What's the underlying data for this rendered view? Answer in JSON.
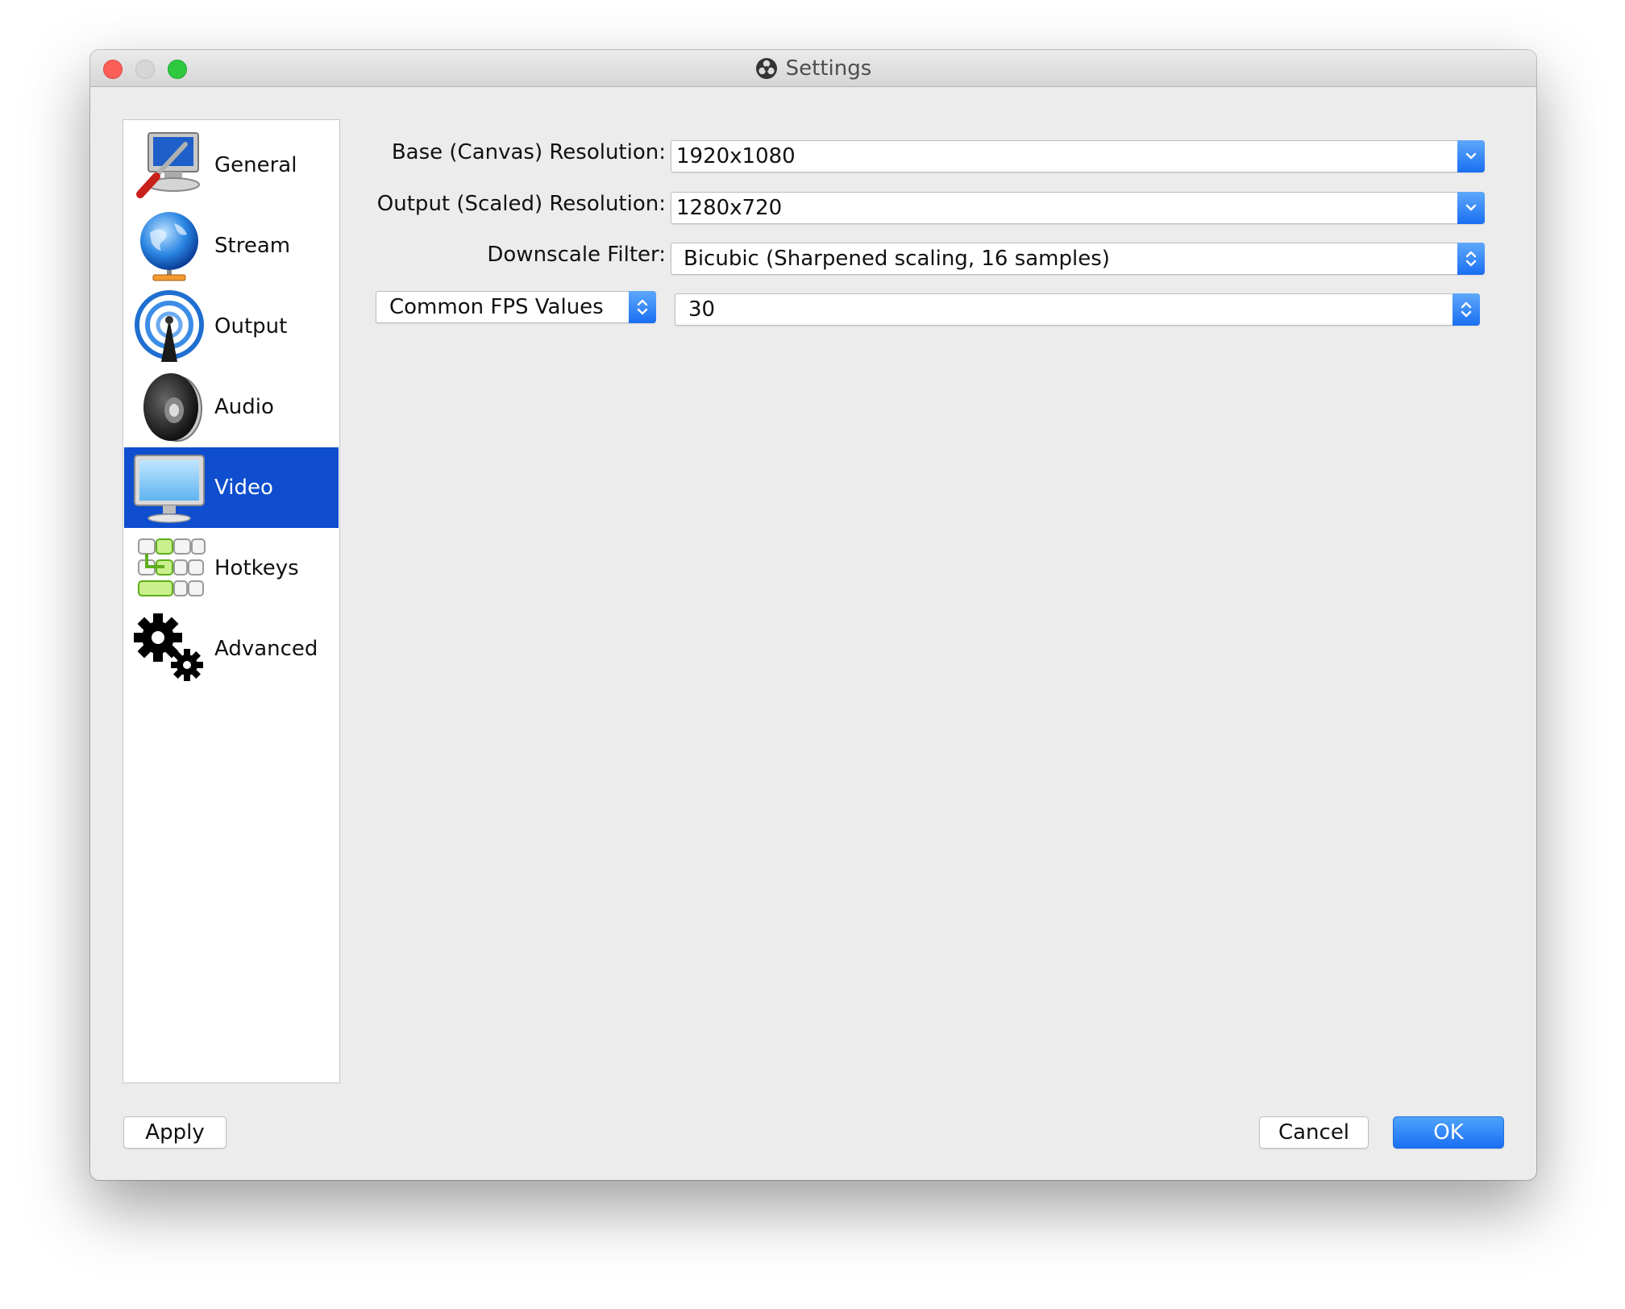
{
  "window": {
    "title": "Settings"
  },
  "sidebar": {
    "items": [
      {
        "label": "General",
        "icon": "general-icon"
      },
      {
        "label": "Stream",
        "icon": "globe-icon"
      },
      {
        "label": "Output",
        "icon": "broadcast-icon"
      },
      {
        "label": "Audio",
        "icon": "speaker-icon"
      },
      {
        "label": "Video",
        "icon": "monitor-icon",
        "selected": true
      },
      {
        "label": "Hotkeys",
        "icon": "keyboard-icon"
      },
      {
        "label": "Advanced",
        "icon": "gears-icon"
      }
    ]
  },
  "video": {
    "base_resolution": {
      "label": "Base (Canvas) Resolution:",
      "value": "1920x1080"
    },
    "output_resolution": {
      "label": "Output (Scaled) Resolution:",
      "value": "1280x720"
    },
    "downscale_filter": {
      "label": "Downscale Filter:",
      "value": "Bicubic (Sharpened scaling, 16 samples)"
    },
    "fps_type": {
      "value": "Common FPS Values"
    },
    "fps_value": {
      "value": "30"
    }
  },
  "buttons": {
    "apply": "Apply",
    "cancel": "Cancel",
    "ok": "OK"
  },
  "colors": {
    "selection": "#0e4ecf",
    "accent": "#1a6ff2",
    "window_bg": "#ececec"
  }
}
